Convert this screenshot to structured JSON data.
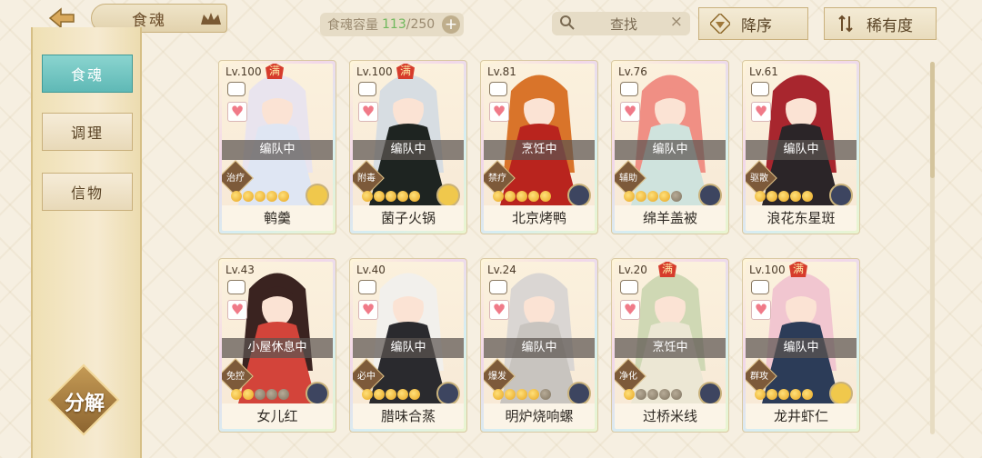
{
  "header": {
    "title": "食魂",
    "capacity_label": "食魂容量",
    "capacity_current": "113",
    "capacity_total": "/250",
    "add_label": "+",
    "search_label": "查找",
    "search_clear": "×",
    "sort_desc_label": "降序",
    "sort_rarity_label": "稀有度"
  },
  "sidebar": {
    "items": [
      {
        "label": "食魂",
        "active": true
      },
      {
        "label": "调理",
        "active": false
      },
      {
        "label": "信物",
        "active": false
      }
    ],
    "decompose_label": "分解"
  },
  "cards": [
    {
      "level": "Lv.100",
      "max": "满",
      "status": "编队中",
      "role": "治疗",
      "stars_on": 5,
      "stars_total": 5,
      "rarity": "gold",
      "name": "鹌羹",
      "hair": "#e9e4ee",
      "robe": "#dfe6f3"
    },
    {
      "level": "Lv.100",
      "max": "满",
      "status": "编队中",
      "role": "附毒",
      "stars_on": 5,
      "stars_total": 5,
      "rarity": "gold",
      "name": "菌子火锅",
      "hair": "#d7dde2",
      "robe": "#1e2421"
    },
    {
      "level": "Lv.81",
      "max": "",
      "status": "烹饪中",
      "role": "禁疗",
      "stars_on": 5,
      "stars_total": 5,
      "rarity": "dark",
      "name": "北京烤鸭",
      "hair": "#d9742a",
      "robe": "#b9241e"
    },
    {
      "level": "Lv.76",
      "max": "",
      "status": "编队中",
      "role": "辅助",
      "stars_on": 4,
      "stars_total": 5,
      "rarity": "dark",
      "name": "绵羊盖被",
      "hair": "#f08f84",
      "robe": "#cfe3dd"
    },
    {
      "level": "Lv.61",
      "max": "",
      "status": "编队中",
      "role": "驱散",
      "stars_on": 5,
      "stars_total": 5,
      "rarity": "dark",
      "name": "浪花东星斑",
      "hair": "#a8262e",
      "robe": "#2b2528"
    },
    {
      "level": "Lv.43",
      "max": "",
      "status": "小屋休息中",
      "role": "免控",
      "stars_on": 2,
      "stars_total": 5,
      "rarity": "dark",
      "name": "女儿红",
      "hair": "#3a2320",
      "robe": "#d3443a"
    },
    {
      "level": "Lv.40",
      "max": "",
      "status": "编队中",
      "role": "必中",
      "stars_on": 5,
      "stars_total": 5,
      "rarity": "dark",
      "name": "腊味合蒸",
      "hair": "#f2f0ec",
      "robe": "#2a2a2e"
    },
    {
      "level": "Lv.24",
      "max": "",
      "status": "编队中",
      "role": "爆发",
      "stars_on": 4,
      "stars_total": 5,
      "rarity": "dark",
      "name": "明炉烧响螺",
      "hair": "#dad6d3",
      "robe": "#c8c4bf"
    },
    {
      "level": "Lv.20",
      "max": "满",
      "status": "烹饪中",
      "role": "净化",
      "stars_on": 1,
      "stars_total": 5,
      "rarity": "dark",
      "name": "过桥米线",
      "hair": "#cfd8b4",
      "robe": "#ece7d4"
    },
    {
      "level": "Lv.100",
      "max": "满",
      "status": "编队中",
      "role": "群攻",
      "stars_on": 5,
      "stars_total": 5,
      "rarity": "gold",
      "name": "龙井虾仁",
      "hair": "#f1c6d0",
      "robe": "#2c3c58"
    }
  ],
  "colors": {
    "accent_teal": "#5fb9b6",
    "gold": "#e7a520",
    "max_badge": "#d63c2c"
  },
  "icons": [
    "back-arrow-icon",
    "crown-icon",
    "search-icon",
    "sort-desc-icon",
    "sort-rarity-icon",
    "plate-icon",
    "heart-icon"
  ]
}
